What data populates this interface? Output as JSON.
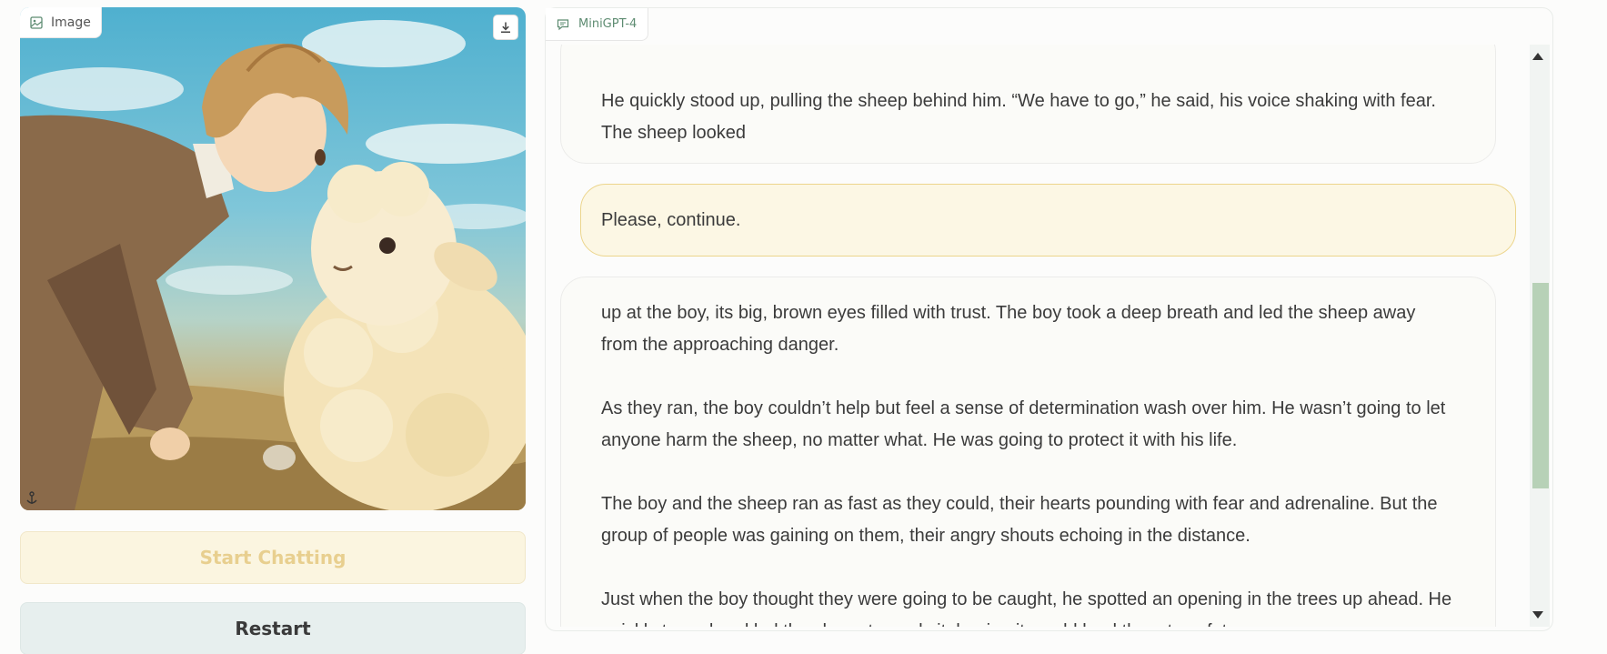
{
  "image_panel": {
    "label": "Image",
    "label_icon": "image-icon",
    "download_icon": "download-icon"
  },
  "buttons": {
    "start_label": "Start Chatting",
    "restart_label": "Restart"
  },
  "chat": {
    "label": "MiniGPT-4",
    "label_icon": "chat-bubble-icon",
    "messages": [
      {
        "role": "bot",
        "paragraphs": [
          "He quickly stood up, pulling the sheep behind him. “We have to go,” he said, his voice shaking with fear. The sheep looked"
        ]
      },
      {
        "role": "user",
        "text": "Please, continue."
      },
      {
        "role": "bot",
        "paragraphs": [
          "up at the boy, its big, brown eyes filled with trust. The boy took a deep breath and led the sheep away from the approaching danger.",
          "As they ran, the boy couldn’t help but feel a sense of determination wash over him. He wasn’t going to let anyone harm the sheep, no matter what. He was going to protect it with his life.",
          "The boy and the sheep ran as fast as they could, their hearts pounding with fear and adrenaline. But the group of people was gaining on them, their angry shouts echoing in the distance.",
          "Just when the boy thought they were going to be caught, he spotted an opening in the trees up ahead. He quickly turned and led the sheep towards it, hoping it would lead them to safety."
        ]
      }
    ]
  },
  "colors": {
    "accent_green": "#5e8c72",
    "scroll_thumb": "#b7d1b7",
    "user_bubble_border": "#ecd58c",
    "user_bubble_bg": "#fcf7e4",
    "start_button_text": "#e8cf8f"
  }
}
